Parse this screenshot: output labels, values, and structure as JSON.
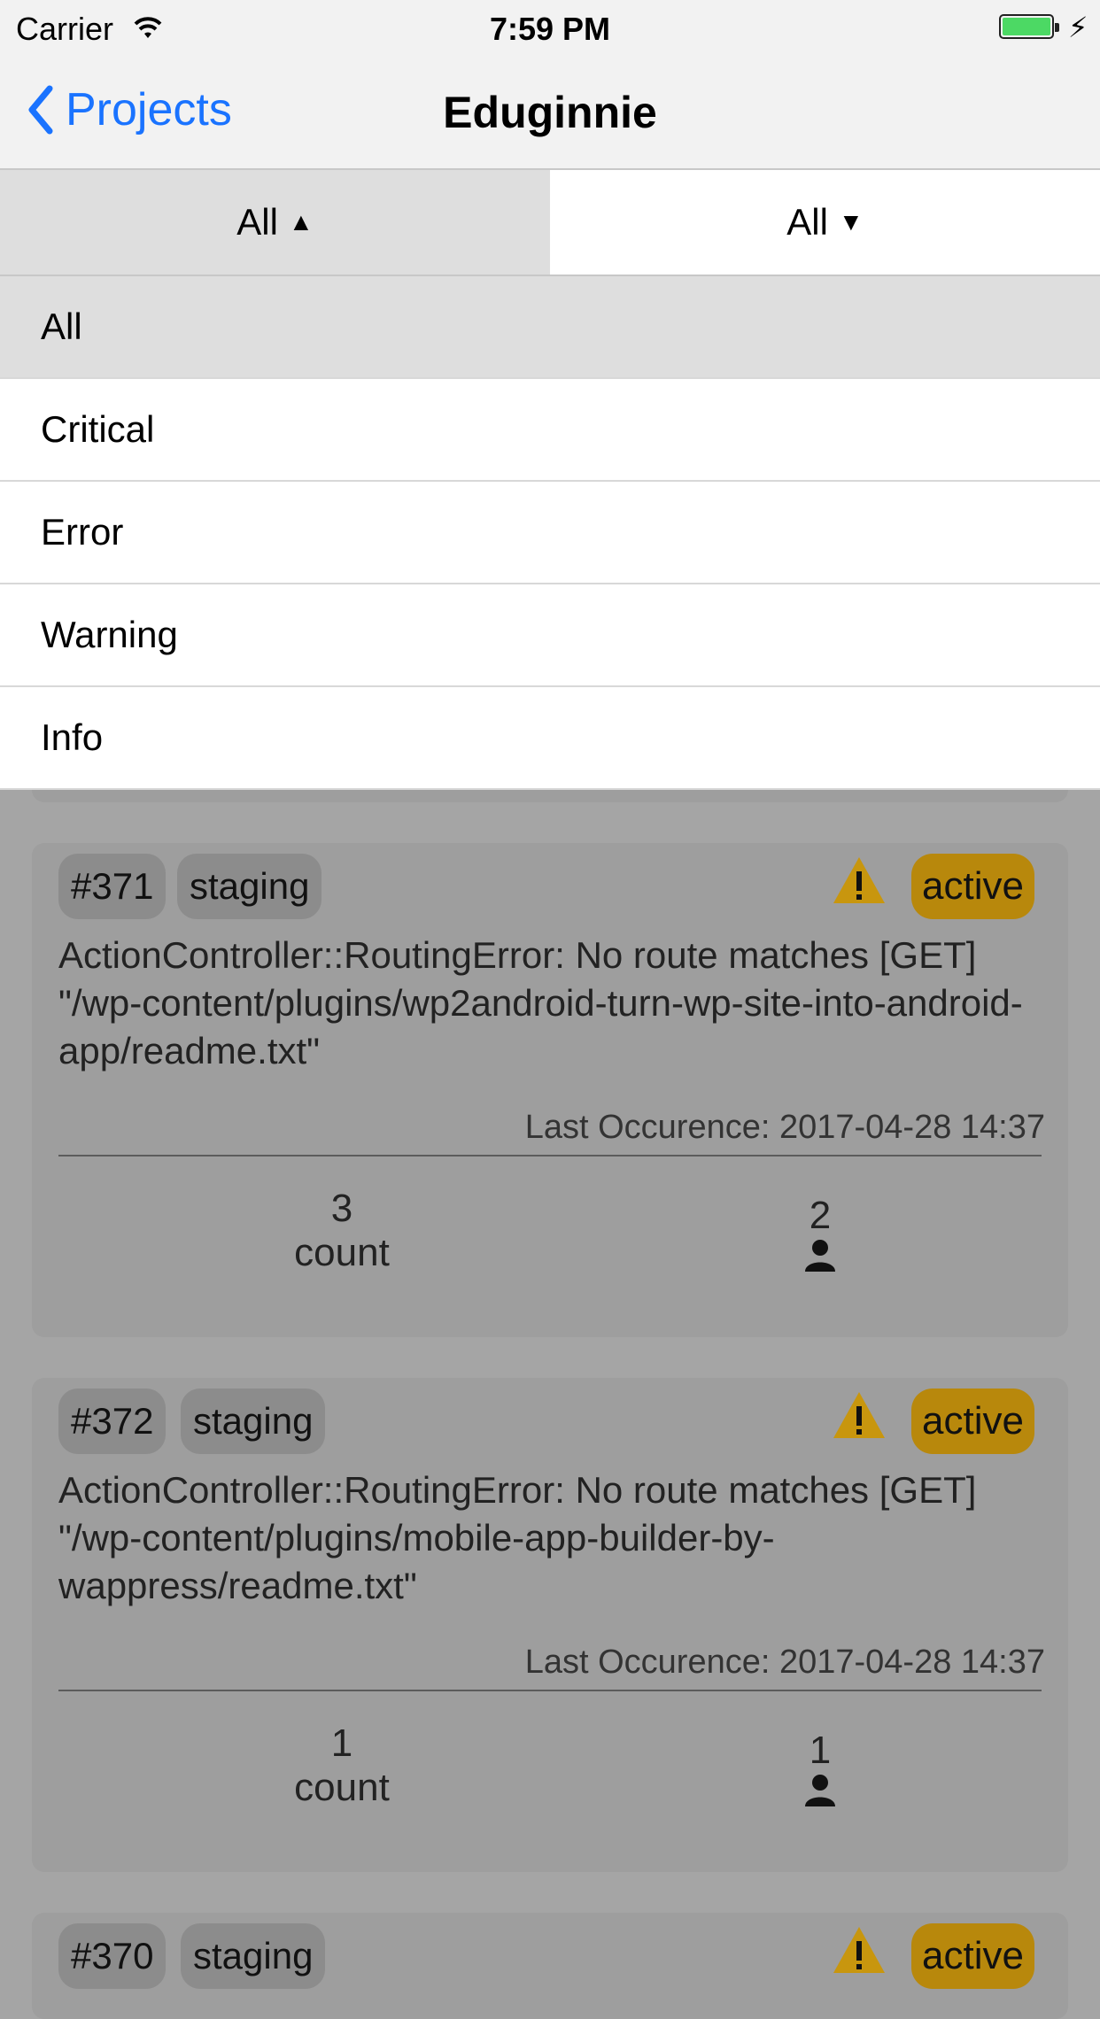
{
  "status_bar": {
    "carrier": "Carrier",
    "time": "7:59 PM"
  },
  "nav": {
    "back_label": "Projects",
    "title": "Eduginnie"
  },
  "filters": {
    "left_label": "All",
    "right_label": "All"
  },
  "dropdown": {
    "items": [
      "All",
      "Critical",
      "Error",
      "Warning",
      "Info"
    ],
    "selected": "All"
  },
  "cards": [
    {
      "id": "#371",
      "env": "staging",
      "status": "active",
      "message": "ActionController::RoutingError: No route matches [GET] \"/wp-content/plugins/wp2android-turn-wp-site-into-android-app/readme.txt\"",
      "last_occurrence": "Last Occurence: 2017-04-28 14:37",
      "count": "3",
      "count_label": "count",
      "users": "2"
    },
    {
      "id": "#372",
      "env": "staging",
      "status": "active",
      "message": "ActionController::RoutingError: No route matches [GET] \"/wp-content/plugins/mobile-app-builder-by-wappress/readme.txt\"",
      "last_occurrence": "Last Occurence: 2017-04-28 14:37",
      "count": "1",
      "count_label": "count",
      "users": "1"
    },
    {
      "id": "#370",
      "env": "staging",
      "status": "active"
    }
  ],
  "colors": {
    "accent": "#1a73ff",
    "active_badge": "#b8880c",
    "warning_icon": "#c8960e"
  }
}
